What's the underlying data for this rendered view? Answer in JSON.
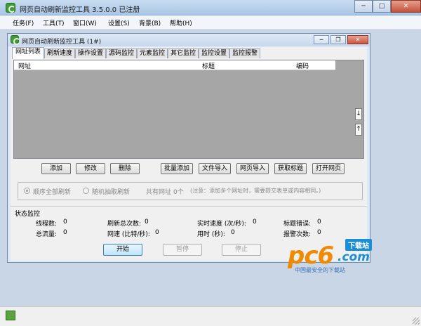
{
  "window": {
    "title": "网页自动刷新监控工具 3.5.0.0  已注册"
  },
  "caption_buttons": {
    "minimize": "─",
    "maximize": "□",
    "close": "✕"
  },
  "menu": [
    {
      "label": "任务(F)"
    },
    {
      "label": "工具(T)"
    },
    {
      "label": "窗口(W)"
    },
    {
      "label": "设置(S)"
    },
    {
      "label": "背景(B)"
    },
    {
      "label": "帮助(H)"
    }
  ],
  "child_window": {
    "title": "网页自动刷新监控工具 (1#)",
    "buttons": {
      "minimize": "─",
      "restore": "❐",
      "close": "✕"
    }
  },
  "tabs": [
    {
      "label": "网址列表",
      "active": true
    },
    {
      "label": "刷新速度"
    },
    {
      "label": "操作设置"
    },
    {
      "label": "源码监控"
    },
    {
      "label": "元素监控"
    },
    {
      "label": "其它监控"
    },
    {
      "label": "监控设置"
    },
    {
      "label": "监控报警"
    }
  ],
  "table": {
    "columns": [
      "网址",
      "标题",
      "编码"
    ]
  },
  "scroll_buttons": {
    "down": "↓",
    "up": "↑"
  },
  "row_buttons_left": [
    "添加",
    "修改",
    "删除"
  ],
  "row_buttons_right": [
    "批量添加",
    "文件导入",
    "网页导入",
    "获取标题",
    "打开网页"
  ],
  "refresh_mode": {
    "option_sequential": "顺序全部刷新",
    "option_random": "随机抽取刷新",
    "total_label": "共有网址",
    "total_value": "0个",
    "note": "(注意：添加多个网址时，需要提交表单或内容相同。)"
  },
  "status": {
    "section_title": "状态监控",
    "stats": [
      {
        "label": "线程数:",
        "value": "0"
      },
      {
        "label": "刷新总次数:",
        "value": "0"
      },
      {
        "label": "实时速度 (次/秒):",
        "value": "0"
      },
      {
        "label": "标题错误:",
        "value": "0"
      },
      {
        "label": "总流量:",
        "value": "0"
      },
      {
        "label": "网速 (比特/秒):",
        "value": "0"
      },
      {
        "label": "用时 (秒):",
        "value": "0"
      },
      {
        "label": "报警次数:",
        "value": "0"
      }
    ]
  },
  "controls": {
    "start": "开始",
    "pause": "暂停",
    "stop": "停止"
  },
  "watermark": {
    "brand_main": "pc6",
    "brand_suffix": ".com",
    "badge": "下载站",
    "tagline": "中国最安全的下载站"
  },
  "colors": {
    "accent": "#3c7fb1",
    "list_bg": "#a6a6a6",
    "brand_green": "#3f9a37",
    "brand_orange": "#f08a00",
    "brand_blue": "#1b8fd6"
  },
  "icons": {
    "app": "app-refresh-icon",
    "statusbar": "status-app-icon"
  }
}
